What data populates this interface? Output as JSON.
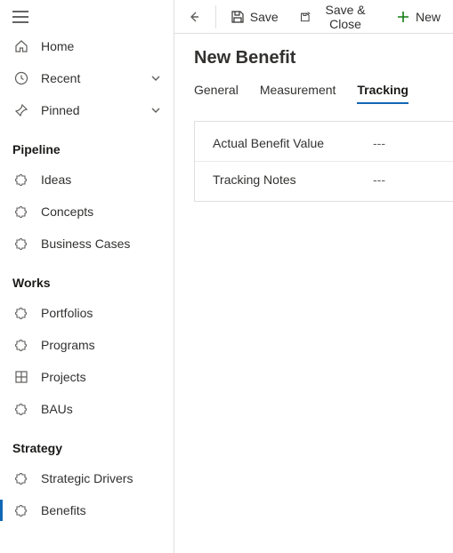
{
  "sidebar": {
    "top": [
      {
        "label": "Home"
      },
      {
        "label": "Recent"
      },
      {
        "label": "Pinned"
      }
    ],
    "sections": [
      {
        "header": "Pipeline",
        "items": [
          {
            "label": "Ideas"
          },
          {
            "label": "Concepts"
          },
          {
            "label": "Business Cases"
          }
        ]
      },
      {
        "header": "Works",
        "items": [
          {
            "label": "Portfolios"
          },
          {
            "label": "Programs"
          },
          {
            "label": "Projects"
          },
          {
            "label": "BAUs"
          }
        ]
      },
      {
        "header": "Strategy",
        "items": [
          {
            "label": "Strategic Drivers"
          },
          {
            "label": "Benefits"
          }
        ]
      }
    ]
  },
  "toolbar": {
    "save_label": "Save",
    "save_close_label": "Save & Close",
    "new_label": "New"
  },
  "page": {
    "title": "New Benefit"
  },
  "tabs": {
    "general": "General",
    "measurement": "Measurement",
    "tracking": "Tracking"
  },
  "fields": {
    "actual_benefit_value": {
      "label": "Actual Benefit Value",
      "value": "---"
    },
    "tracking_notes": {
      "label": "Tracking Notes",
      "value": "---"
    }
  }
}
